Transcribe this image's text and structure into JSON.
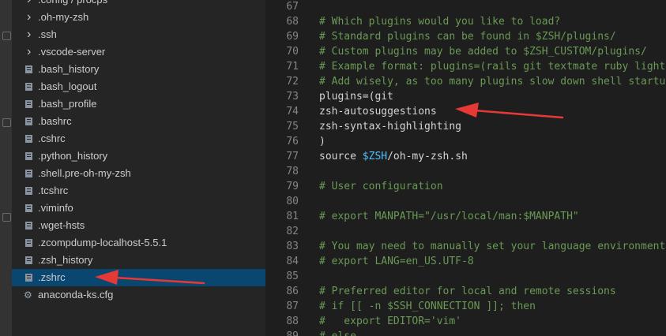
{
  "explorer": {
    "items": [
      {
        "label": ".config / procps",
        "kind": "folder",
        "icon": "chevron-right-icon"
      },
      {
        "label": ".oh-my-zsh",
        "kind": "folder",
        "icon": "chevron-right-icon"
      },
      {
        "label": ".ssh",
        "kind": "folder",
        "icon": "chevron-right-icon"
      },
      {
        "label": ".vscode-server",
        "kind": "folder",
        "icon": "chevron-right-icon"
      },
      {
        "label": ".bash_history",
        "kind": "file",
        "icon": "file-icon"
      },
      {
        "label": ".bash_logout",
        "kind": "file",
        "icon": "file-icon"
      },
      {
        "label": ".bash_profile",
        "kind": "file",
        "icon": "file-icon"
      },
      {
        "label": ".bashrc",
        "kind": "file",
        "icon": "file-icon"
      },
      {
        "label": ".cshrc",
        "kind": "file",
        "icon": "file-icon"
      },
      {
        "label": ".python_history",
        "kind": "file",
        "icon": "file-icon"
      },
      {
        "label": ".shell.pre-oh-my-zsh",
        "kind": "file",
        "icon": "file-icon"
      },
      {
        "label": ".tcshrc",
        "kind": "file",
        "icon": "file-icon"
      },
      {
        "label": ".viminfo",
        "kind": "file",
        "icon": "file-icon"
      },
      {
        "label": ".wget-hsts",
        "kind": "file",
        "icon": "file-icon"
      },
      {
        "label": ".zcompdump-localhost-5.5.1",
        "kind": "file",
        "icon": "file-icon"
      },
      {
        "label": ".zsh_history",
        "kind": "file",
        "icon": "file-icon"
      },
      {
        "label": ".zshrc",
        "kind": "file",
        "icon": "file-icon",
        "selected": true
      },
      {
        "label": "anaconda-ks.cfg",
        "kind": "file",
        "icon": "gear-icon"
      }
    ]
  },
  "editor": {
    "lines": [
      {
        "num": "67",
        "text": ""
      },
      {
        "num": "68",
        "text": "# Which plugins would you like to load?",
        "style": "comment"
      },
      {
        "num": "69",
        "text": "# Standard plugins can be found in $ZSH/plugins/",
        "style": "comment"
      },
      {
        "num": "70",
        "text": "# Custom plugins may be added to $ZSH_CUSTOM/plugins/",
        "style": "comment"
      },
      {
        "num": "71",
        "text": "# Example format: plugins=(rails git textmate ruby lighth",
        "style": "comment"
      },
      {
        "num": "72",
        "text": "# Add wisely, as too many plugins slow down shell startup",
        "style": "comment"
      },
      {
        "num": "73",
        "text": "plugins=(git"
      },
      {
        "num": "74",
        "text": "zsh-autosuggestions"
      },
      {
        "num": "75",
        "text": "zsh-syntax-highlighting"
      },
      {
        "num": "76",
        "text": ")"
      },
      {
        "num": "77",
        "text": "source $ZSH/oh-my-zsh.sh",
        "parts": [
          "source ",
          "$ZSH",
          "/oh-my-zsh.sh"
        ]
      },
      {
        "num": "78",
        "text": ""
      },
      {
        "num": "79",
        "text": "# User configuration",
        "style": "comment"
      },
      {
        "num": "80",
        "text": ""
      },
      {
        "num": "81",
        "text": "# export MANPATH=\"/usr/local/man:$MANPATH\"",
        "style": "comment"
      },
      {
        "num": "82",
        "text": ""
      },
      {
        "num": "83",
        "text": "# You may need to manually set your language environment",
        "style": "comment"
      },
      {
        "num": "84",
        "text": "# export LANG=en_US.UTF-8",
        "style": "comment"
      },
      {
        "num": "85",
        "text": ""
      },
      {
        "num": "86",
        "text": "# Preferred editor for local and remote sessions",
        "style": "comment"
      },
      {
        "num": "87",
        "text": "# if [[ -n $SSH_CONNECTION ]]; then",
        "style": "comment"
      },
      {
        "num": "88",
        "text": "#   export EDITOR='vim'",
        "style": "comment"
      },
      {
        "num": "89",
        "text": "# else",
        "style": "comment"
      }
    ]
  },
  "colors": {
    "sidebar_bg": "#252526",
    "editor_bg": "#1e1e1e",
    "selection": "#094771",
    "comment": "#6a9955",
    "variable": "#4fc1ff",
    "annotation_arrow": "#e53935"
  }
}
